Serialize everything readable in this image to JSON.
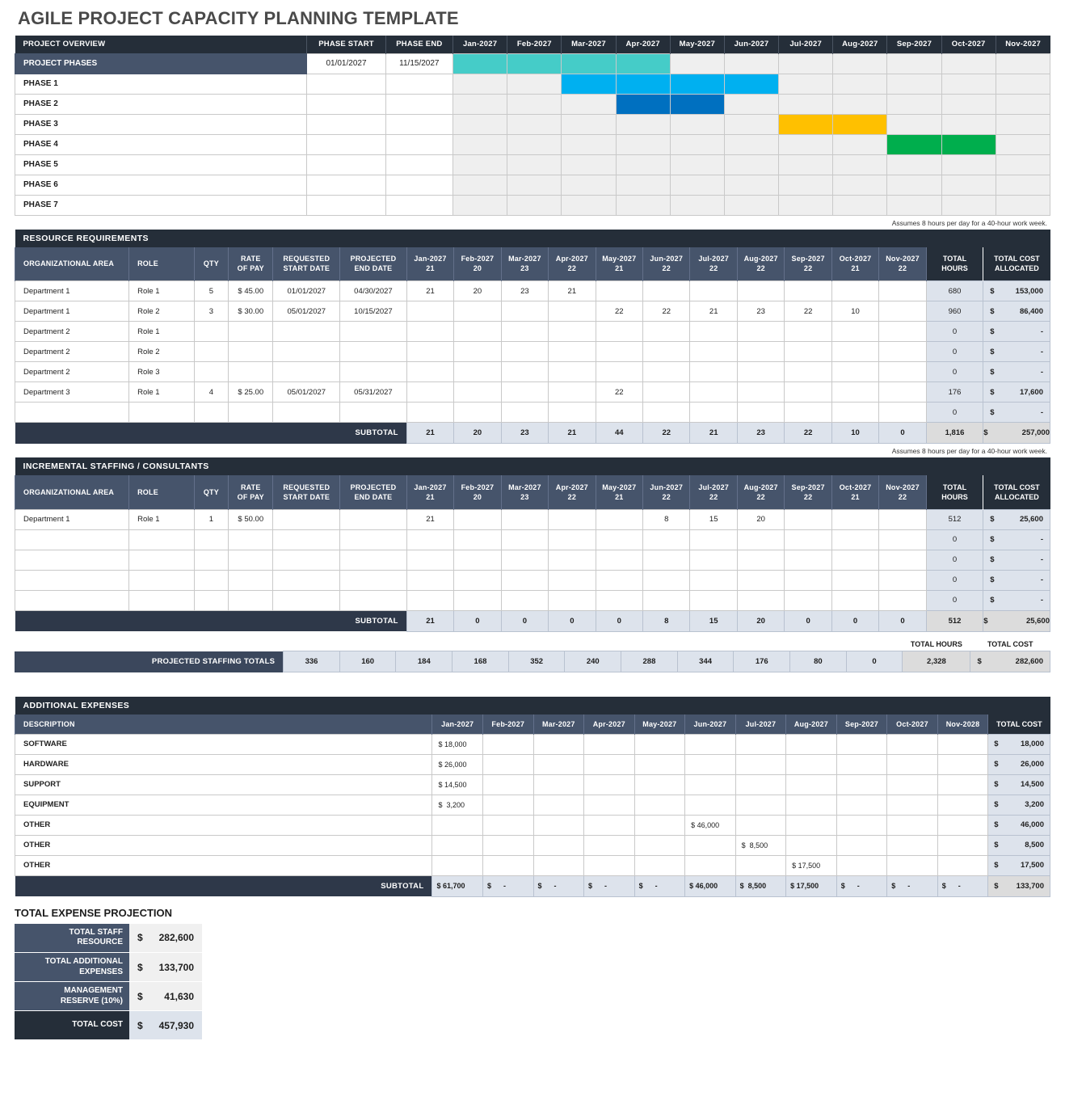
{
  "page_title": "AGILE PROJECT CAPACITY PLANNING TEMPLATE",
  "colors": {
    "header_dark": "#252e39",
    "header_mid": "#46546b",
    "gantt_teal": "#45ccc8",
    "gantt_lightblue": "#00b0f0",
    "gantt_darkblue": "#0070c0",
    "gantt_orange": "#ffc000",
    "gantt_green": "#00ae4d",
    "total_fill": "#dde3ec"
  },
  "footnote": "Assumes 8 hours per day for a 40-hour work week.",
  "overview": {
    "section_label": "PROJECT OVERVIEW",
    "col_phase_start": "PHASE START",
    "col_phase_end": "PHASE END",
    "months": [
      "Jan-2027",
      "Feb-2027",
      "Mar-2027",
      "Apr-2027",
      "May-2027",
      "Jun-2027",
      "Jul-2027",
      "Aug-2027",
      "Sep-2027",
      "Oct-2027",
      "Nov-2027"
    ],
    "rows": [
      {
        "label": "PROJECT PHASES",
        "start": "01/01/2027",
        "end": "11/15/2027",
        "highlight": true,
        "bars": [
          1,
          1,
          1,
          1,
          0,
          0,
          0,
          0,
          0,
          0,
          0
        ],
        "color": "#45ccc8"
      },
      {
        "label": "PHASE 1",
        "start": "",
        "end": "",
        "highlight": false,
        "bars": [
          0,
          0,
          1,
          1,
          1,
          1,
          0,
          0,
          0,
          0,
          0
        ],
        "color": "#00b0f0"
      },
      {
        "label": "PHASE 2",
        "start": "",
        "end": "",
        "highlight": false,
        "bars": [
          0,
          0,
          0,
          1,
          1,
          0,
          0,
          0,
          0,
          0,
          0
        ],
        "color": "#0070c0"
      },
      {
        "label": "PHASE 3",
        "start": "",
        "end": "",
        "highlight": false,
        "bars": [
          0,
          0,
          0,
          0,
          0,
          0,
          1,
          1,
          0,
          0,
          0
        ],
        "color": "#ffc000"
      },
      {
        "label": "PHASE 4",
        "start": "",
        "end": "",
        "highlight": false,
        "bars": [
          0,
          0,
          0,
          0,
          0,
          0,
          0,
          0,
          1,
          1,
          0
        ],
        "color": "#00ae4d"
      },
      {
        "label": "PHASE 5",
        "start": "",
        "end": "",
        "highlight": false,
        "bars": [
          0,
          0,
          0,
          0,
          0,
          0,
          0,
          0,
          0,
          0,
          0
        ],
        "color": ""
      },
      {
        "label": "PHASE 6",
        "start": "",
        "end": "",
        "highlight": false,
        "bars": [
          0,
          0,
          0,
          0,
          0,
          0,
          0,
          0,
          0,
          0,
          0
        ],
        "color": ""
      },
      {
        "label": "PHASE 7",
        "start": "",
        "end": "",
        "highlight": false,
        "bars": [
          0,
          0,
          0,
          0,
          0,
          0,
          0,
          0,
          0,
          0,
          0
        ],
        "color": ""
      }
    ]
  },
  "resource": {
    "section_label": "RESOURCE REQUIREMENTS",
    "columns": [
      "ORGANIZATIONAL AREA",
      "ROLE",
      "QTY",
      "RATE\nOF PAY",
      "REQUESTED\nSTART DATE",
      "PROJECTED\nEND DATE"
    ],
    "col_org": "ORGANIZATIONAL AREA",
    "col_role": "ROLE",
    "col_qty": "QTY",
    "col_rate_1": "RATE",
    "col_rate_2": "OF PAY",
    "col_req_1": "REQUESTED",
    "col_req_2": "START DATE",
    "col_proj_1": "PROJECTED",
    "col_proj_2": "END DATE",
    "col_total_hours_1": "TOTAL",
    "col_total_hours_2": "HOURS",
    "col_total_cost_1": "TOTAL COST",
    "col_total_cost_2": "ALLOCATED",
    "months": [
      "Jan-2027",
      "Feb-2027",
      "Mar-2027",
      "Apr-2027",
      "May-2027",
      "Jun-2027",
      "Jul-2027",
      "Aug-2027",
      "Sep-2027",
      "Oct-2027",
      "Nov-2027"
    ],
    "month_days": [
      "21",
      "20",
      "23",
      "22",
      "21",
      "22",
      "22",
      "22",
      "22",
      "21",
      "22"
    ],
    "rows": [
      {
        "org": "Department 1",
        "role": "Role 1",
        "qty": "5",
        "rate": "$ 45.00",
        "start": "01/01/2027",
        "end": "04/30/2027",
        "months": [
          "21",
          "20",
          "23",
          "21",
          "",
          "",
          "",
          "",
          "",
          "",
          ""
        ],
        "hours": "680",
        "cost_sym": "$",
        "cost": "153,000"
      },
      {
        "org": "Department 1",
        "role": "Role 2",
        "qty": "3",
        "rate": "$ 30.00",
        "start": "05/01/2027",
        "end": "10/15/2027",
        "months": [
          "",
          "",
          "",
          "",
          "22",
          "22",
          "21",
          "23",
          "22",
          "10",
          ""
        ],
        "hours": "960",
        "cost_sym": "$",
        "cost": "86,400"
      },
      {
        "org": "Department 2",
        "role": "Role 1",
        "qty": "",
        "rate": "",
        "start": "",
        "end": "",
        "months": [
          "",
          "",
          "",
          "",
          "",
          "",
          "",
          "",
          "",
          "",
          ""
        ],
        "hours": "0",
        "cost_sym": "$",
        "cost": "-"
      },
      {
        "org": "Department 2",
        "role": "Role 2",
        "qty": "",
        "rate": "",
        "start": "",
        "end": "",
        "months": [
          "",
          "",
          "",
          "",
          "",
          "",
          "",
          "",
          "",
          "",
          ""
        ],
        "hours": "0",
        "cost_sym": "$",
        "cost": "-"
      },
      {
        "org": "Department 2",
        "role": "Role 3",
        "qty": "",
        "rate": "",
        "start": "",
        "end": "",
        "months": [
          "",
          "",
          "",
          "",
          "",
          "",
          "",
          "",
          "",
          "",
          ""
        ],
        "hours": "0",
        "cost_sym": "$",
        "cost": "-"
      },
      {
        "org": "Department 3",
        "role": "Role 1",
        "qty": "4",
        "rate": "$ 25.00",
        "start": "05/01/2027",
        "end": "05/31/2027",
        "months": [
          "",
          "",
          "",
          "",
          "22",
          "",
          "",
          "",
          "",
          "",
          ""
        ],
        "hours": "176",
        "cost_sym": "$",
        "cost": "17,600"
      },
      {
        "org": "",
        "role": "",
        "qty": "",
        "rate": "",
        "start": "",
        "end": "",
        "months": [
          "",
          "",
          "",
          "",
          "",
          "",
          "",
          "",
          "",
          "",
          ""
        ],
        "hours": "0",
        "cost_sym": "$",
        "cost": "-"
      }
    ],
    "subtotal_label": "SUBTOTAL",
    "subtotal_months": [
      "21",
      "20",
      "23",
      "21",
      "44",
      "22",
      "21",
      "23",
      "22",
      "10",
      "0"
    ],
    "subtotal_hours": "1,816",
    "subtotal_cost_sym": "$",
    "subtotal_cost": "257,000"
  },
  "incremental": {
    "section_label": "INCREMENTAL STAFFING / CONSULTANTS",
    "col_org": "ORGANIZATIONAL AREA",
    "col_role": "ROLE",
    "col_qty": "QTY",
    "col_rate_1": "RATE",
    "col_rate_2": "OF PAY",
    "col_req_1": "REQUESTED",
    "col_req_2": "START DATE",
    "col_proj_1": "PROJECTED",
    "col_proj_2": "END DATE",
    "col_total_hours_1": "TOTAL",
    "col_total_hours_2": "HOURS",
    "col_total_cost_1": "TOTAL COST",
    "col_total_cost_2": "ALLOCATED",
    "months": [
      "Jan-2027",
      "Feb-2027",
      "Mar-2027",
      "Apr-2027",
      "May-2027",
      "Jun-2027",
      "Jul-2027",
      "Aug-2027",
      "Sep-2027",
      "Oct-2027",
      "Nov-2027"
    ],
    "month_days": [
      "21",
      "20",
      "23",
      "22",
      "21",
      "22",
      "22",
      "22",
      "22",
      "21",
      "22"
    ],
    "rows": [
      {
        "org": "Department 1",
        "role": "Role 1",
        "qty": "1",
        "rate": "$ 50.00",
        "start": "",
        "end": "",
        "months": [
          "21",
          "",
          "",
          "",
          "",
          "8",
          "15",
          "20",
          "",
          "",
          ""
        ],
        "hours": "512",
        "cost_sym": "$",
        "cost": "25,600"
      },
      {
        "org": "",
        "role": "",
        "qty": "",
        "rate": "",
        "start": "",
        "end": "",
        "months": [
          "",
          "",
          "",
          "",
          "",
          "",
          "",
          "",
          "",
          "",
          ""
        ],
        "hours": "0",
        "cost_sym": "$",
        "cost": "-"
      },
      {
        "org": "",
        "role": "",
        "qty": "",
        "rate": "",
        "start": "",
        "end": "",
        "months": [
          "",
          "",
          "",
          "",
          "",
          "",
          "",
          "",
          "",
          "",
          ""
        ],
        "hours": "0",
        "cost_sym": "$",
        "cost": "-"
      },
      {
        "org": "",
        "role": "",
        "qty": "",
        "rate": "",
        "start": "",
        "end": "",
        "months": [
          "",
          "",
          "",
          "",
          "",
          "",
          "",
          "",
          "",
          "",
          ""
        ],
        "hours": "0",
        "cost_sym": "$",
        "cost": "-"
      },
      {
        "org": "",
        "role": "",
        "qty": "",
        "rate": "",
        "start": "",
        "end": "",
        "months": [
          "",
          "",
          "",
          "",
          "",
          "",
          "",
          "",
          "",
          "",
          ""
        ],
        "hours": "0",
        "cost_sym": "$",
        "cost": "-"
      }
    ],
    "subtotal_label": "SUBTOTAL",
    "subtotal_months": [
      "21",
      "0",
      "0",
      "0",
      "0",
      "8",
      "15",
      "20",
      "0",
      "0",
      "0"
    ],
    "subtotal_hours": "512",
    "subtotal_cost_sym": "$",
    "subtotal_cost": "25,600"
  },
  "staffing_totals": {
    "mini_hours_label": "TOTAL HOURS",
    "mini_cost_label": "TOTAL COST",
    "label": "PROJECTED STAFFING TOTALS",
    "months": [
      "336",
      "160",
      "184",
      "168",
      "352",
      "240",
      "288",
      "344",
      "176",
      "80",
      "0"
    ],
    "hours": "2,328",
    "cost_sym": "$",
    "cost": "282,600"
  },
  "expenses": {
    "section_label": "ADDITIONAL EXPENSES",
    "col_description": "DESCRIPTION",
    "months": [
      "Jan-2027",
      "Feb-2027",
      "Mar-2027",
      "Apr-2027",
      "May-2027",
      "Jun-2027",
      "Jul-2027",
      "Aug-2027",
      "Sep-2027",
      "Oct-2027",
      "Nov-2028"
    ],
    "col_total_cost": "TOTAL COST",
    "rows": [
      {
        "desc": "SOFTWARE",
        "months": [
          "$ 18,000",
          "",
          "",
          "",
          "",
          "",
          "",
          "",
          "",
          "",
          ""
        ],
        "total_sym": "$",
        "total": "18,000"
      },
      {
        "desc": "HARDWARE",
        "months": [
          "$ 26,000",
          "",
          "",
          "",
          "",
          "",
          "",
          "",
          "",
          "",
          ""
        ],
        "total_sym": "$",
        "total": "26,000"
      },
      {
        "desc": "SUPPORT",
        "months": [
          "$ 14,500",
          "",
          "",
          "",
          "",
          "",
          "",
          "",
          "",
          "",
          ""
        ],
        "total_sym": "$",
        "total": "14,500"
      },
      {
        "desc": "EQUIPMENT",
        "months": [
          "$  3,200",
          "",
          "",
          "",
          "",
          "",
          "",
          "",
          "",
          "",
          ""
        ],
        "total_sym": "$",
        "total": "3,200"
      },
      {
        "desc": "OTHER",
        "months": [
          "",
          "",
          "",
          "",
          "",
          "$ 46,000",
          "",
          "",
          "",
          "",
          ""
        ],
        "total_sym": "$",
        "total": "46,000"
      },
      {
        "desc": "OTHER",
        "months": [
          "",
          "",
          "",
          "",
          "",
          "",
          "$  8,500",
          "",
          "",
          "",
          ""
        ],
        "total_sym": "$",
        "total": "8,500"
      },
      {
        "desc": "OTHER",
        "months": [
          "",
          "",
          "",
          "",
          "",
          "",
          "",
          "$ 17,500",
          "",
          "",
          ""
        ],
        "total_sym": "$",
        "total": "17,500"
      }
    ],
    "subtotal_label": "SUBTOTAL",
    "subtotal_months": [
      "$ 61,700",
      "$      -",
      "$      -",
      "$      -",
      "$      -",
      "$ 46,000",
      "$  8,500",
      "$ 17,500",
      "$      -",
      "$      -",
      "$      -"
    ],
    "subtotal_total_sym": "$",
    "subtotal_total": "133,700"
  },
  "projection": {
    "title": "TOTAL EXPENSE PROJECTION",
    "rows": [
      {
        "label_1": "TOTAL STAFF",
        "label_2": "RESOURCE",
        "sym": "$",
        "value": "282,600",
        "dark": false
      },
      {
        "label_1": "TOTAL ADDITIONAL",
        "label_2": "EXPENSES",
        "sym": "$",
        "value": "133,700",
        "dark": false
      },
      {
        "label_1": "MANAGEMENT",
        "label_2": "RESERVE (10%)",
        "sym": "$",
        "value": "41,630",
        "dark": false
      },
      {
        "label_1": "TOTAL COST",
        "label_2": "",
        "sym": "$",
        "value": "457,930",
        "dark": true
      }
    ]
  }
}
